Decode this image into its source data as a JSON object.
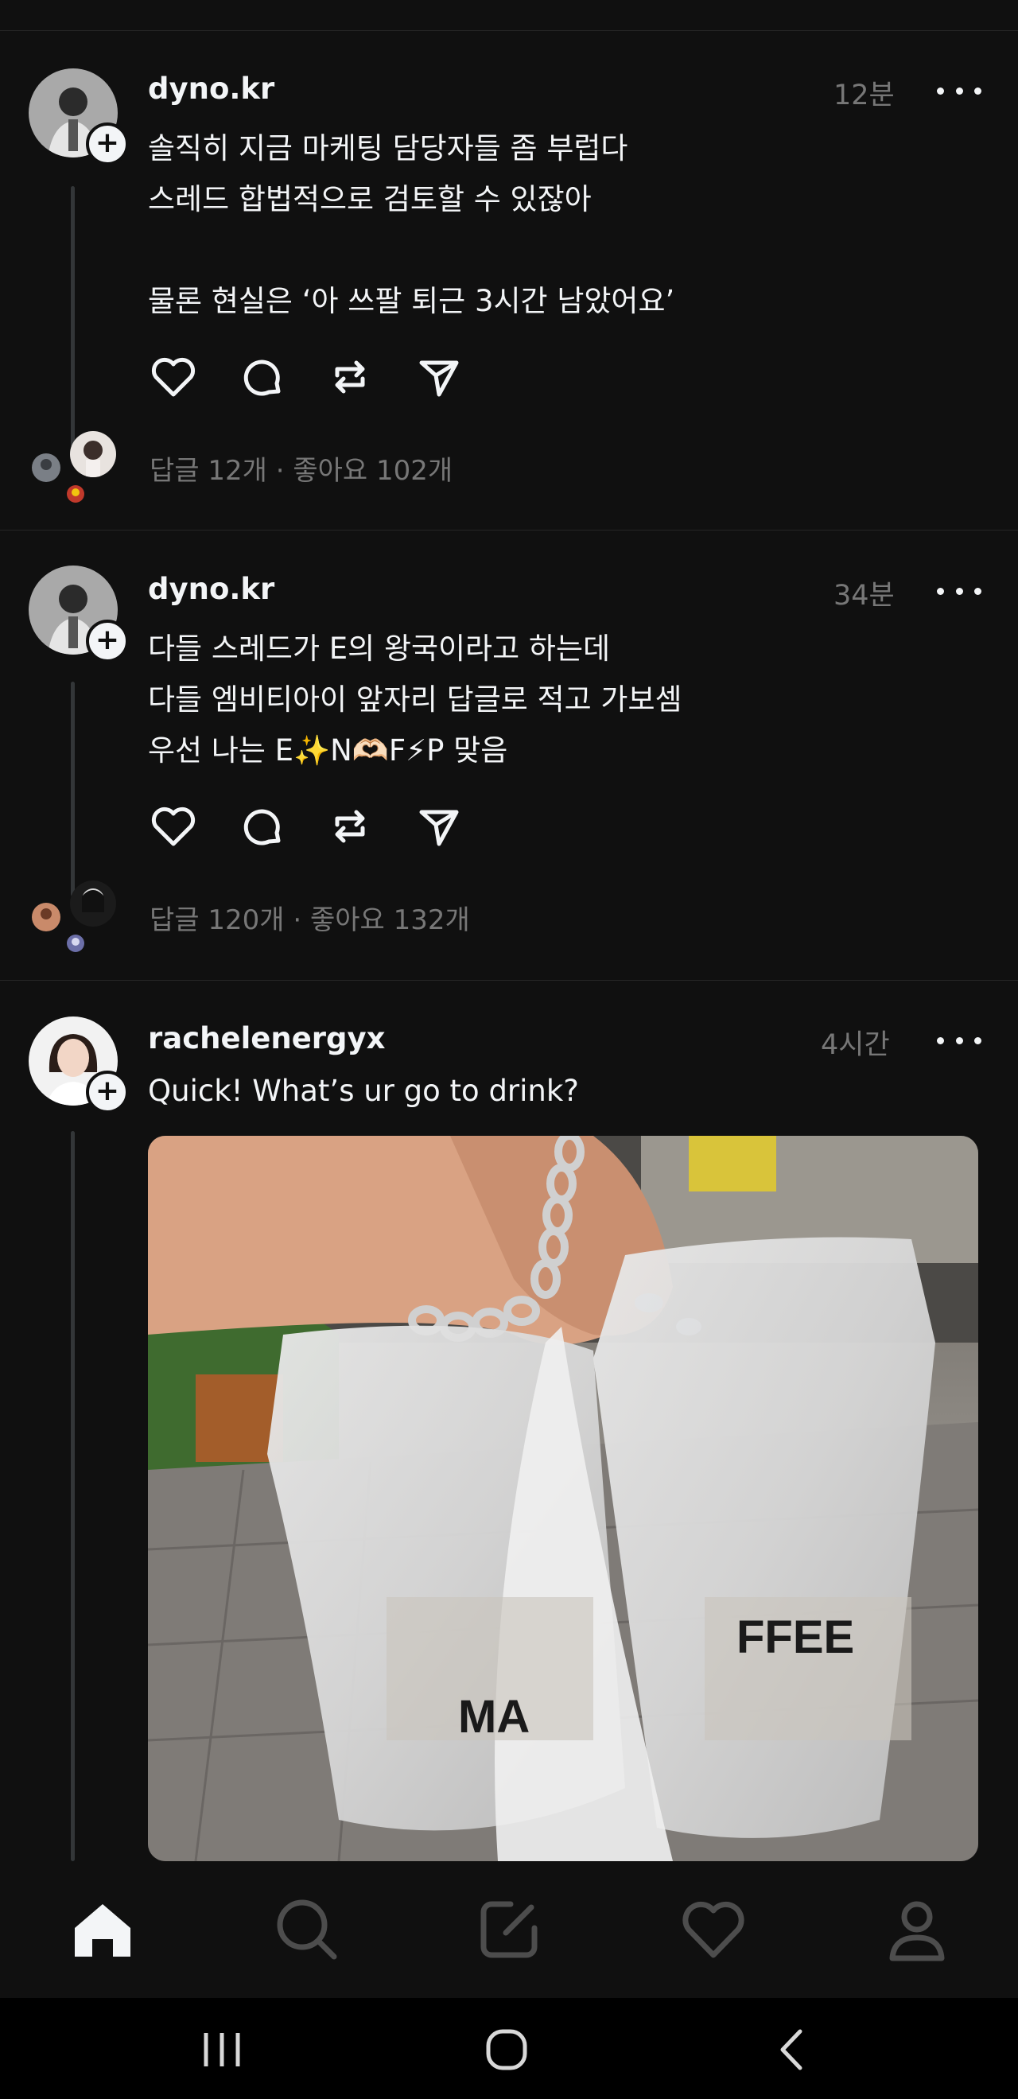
{
  "posts": [
    {
      "username": "dyno.kr",
      "time": "12분",
      "lines": [
        "솔직히 지금 마케팅 담당자들 좀 부럽다",
        "스레드 합법적으로 검토할 수 있잖아",
        "",
        "물론 현실은 ‘아 쓰팔 퇴근 3시간 남았어요’"
      ],
      "stats": "답글 12개 · 좋아요 102개"
    },
    {
      "username": "dyno.kr",
      "time": "34분",
      "lines": [
        "다들 스레드가 E의 왕국이라고 하는데",
        "다들 엠비티아이 앞자리 답글로 적고 가보셈",
        "우선 나는 E✨N🫶🏻F⚡P 맞음"
      ],
      "stats": "답글 120개 · 좋아요 132개"
    },
    {
      "username": "rachelenergyx",
      "time": "4시간",
      "lines": [
        "Quick! What’s ur go to drink?"
      ],
      "image_text": [
        "MA",
        "FFEE"
      ]
    }
  ],
  "colors": {
    "background": "#101010",
    "text": "#f3f5f7",
    "secondary": "#777777",
    "divider": "#262626"
  },
  "icons": {
    "post_actions": [
      "heart-icon",
      "comment-icon",
      "repost-icon",
      "share-icon"
    ],
    "nav": [
      "home-icon",
      "search-icon",
      "compose-icon",
      "activity-heart-icon",
      "profile-icon"
    ],
    "system": [
      "recents-icon",
      "home-circle-icon",
      "back-icon"
    ]
  }
}
